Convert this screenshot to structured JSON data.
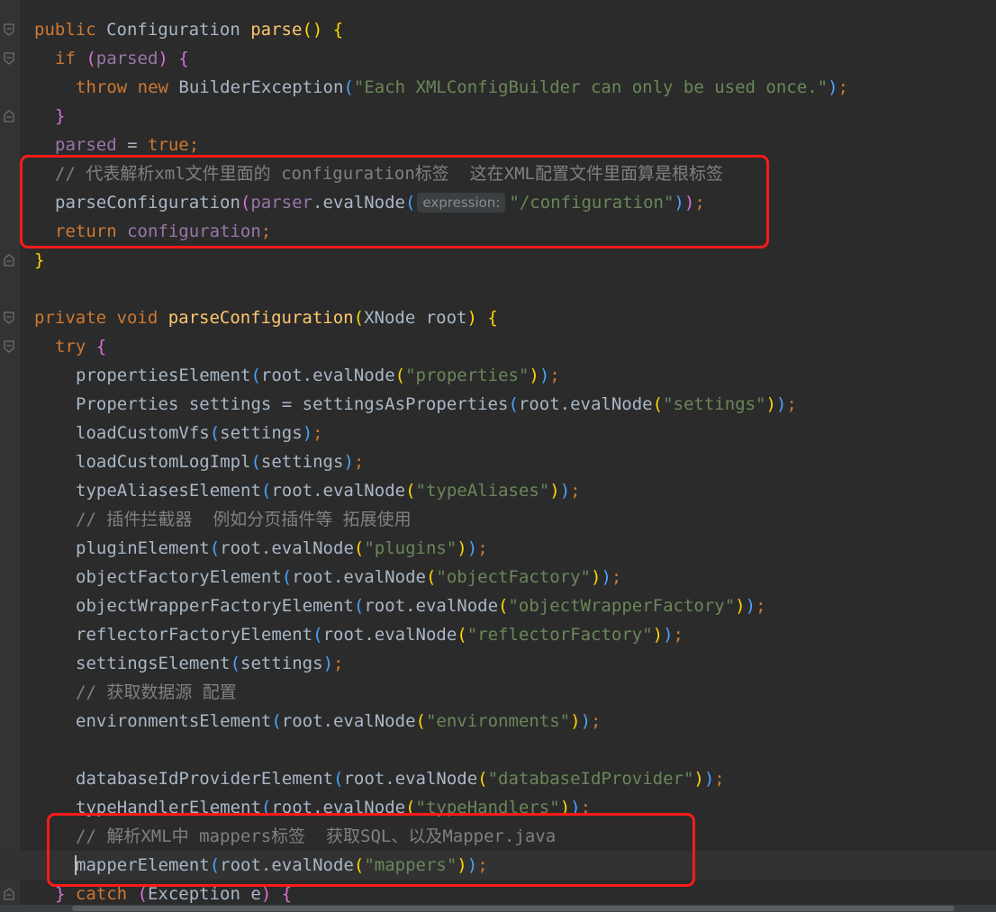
{
  "editor": {
    "colors": {
      "background": "#2b2b2b",
      "keyword": "#cc7832",
      "method": "#ffc66d",
      "string": "#6a8759",
      "field": "#9876aa",
      "comment": "#808080",
      "highlight_box": "#ff1a1a"
    },
    "highlights": [
      "parse-comment-block",
      "mapper-element-block"
    ],
    "lines": [
      {
        "indent": 0,
        "fold": "open",
        "tokens": [
          {
            "t": "public ",
            "c": "kw"
          },
          {
            "t": "Configuration ",
            "c": "pl"
          },
          {
            "t": "parse",
            "c": "fn"
          },
          {
            "t": "() ",
            "c": "b1"
          },
          {
            "t": "{",
            "c": "b1"
          }
        ]
      },
      {
        "indent": 1,
        "fold": "open",
        "tokens": [
          {
            "t": "if ",
            "c": "kw"
          },
          {
            "t": "(",
            "c": "b2"
          },
          {
            "t": "parsed",
            "c": "fld"
          },
          {
            "t": ") ",
            "c": "b2"
          },
          {
            "t": "{",
            "c": "b2"
          }
        ]
      },
      {
        "indent": 2,
        "tokens": [
          {
            "t": "throw new ",
            "c": "kw"
          },
          {
            "t": "BuilderException",
            "c": "pl"
          },
          {
            "t": "(",
            "c": "b3"
          },
          {
            "t": "\"Each XMLConfigBuilder can only be used once.\"",
            "c": "str"
          },
          {
            "t": ")",
            "c": "b3"
          },
          {
            "t": ";",
            "c": "kw"
          }
        ]
      },
      {
        "indent": 1,
        "fold": "close",
        "tokens": [
          {
            "t": "}",
            "c": "b2"
          }
        ]
      },
      {
        "indent": 1,
        "tokens": [
          {
            "t": "parsed",
            "c": "fld"
          },
          {
            "t": " = ",
            "c": "pl"
          },
          {
            "t": "true",
            "c": "kw"
          },
          {
            "t": ";",
            "c": "kw"
          }
        ]
      },
      {
        "indent": 1,
        "tokens": [
          {
            "t": "// 代表解析xml文件里面的 configuration标签  这在XML配置文件里面算是根标签",
            "c": "cmt"
          }
        ]
      },
      {
        "indent": 1,
        "tokens": [
          {
            "t": "parseConfiguration",
            "c": "pl"
          },
          {
            "t": "(",
            "c": "b2"
          },
          {
            "t": "parser",
            "c": "fld"
          },
          {
            "t": ".evalNode",
            "c": "pl"
          },
          {
            "t": "(",
            "c": "b3"
          },
          {
            "t": "expression:",
            "c": "hint"
          },
          {
            "t": "\"/configuration\"",
            "c": "str"
          },
          {
            "t": ")",
            "c": "b3"
          },
          {
            "t": ")",
            "c": "b2"
          },
          {
            "t": ";",
            "c": "kw"
          }
        ]
      },
      {
        "indent": 1,
        "tokens": [
          {
            "t": "return ",
            "c": "kw"
          },
          {
            "t": "configuration",
            "c": "fld"
          },
          {
            "t": ";",
            "c": "kw"
          }
        ]
      },
      {
        "indent": 0,
        "fold": "close",
        "tokens": [
          {
            "t": "}",
            "c": "b1"
          }
        ]
      },
      {
        "indent": 0,
        "tokens": []
      },
      {
        "indent": 0,
        "fold": "open",
        "tokens": [
          {
            "t": "private void ",
            "c": "kw"
          },
          {
            "t": "parseConfiguration",
            "c": "fn"
          },
          {
            "t": "(",
            "c": "b1"
          },
          {
            "t": "XNode root",
            "c": "pl"
          },
          {
            "t": ") ",
            "c": "b1"
          },
          {
            "t": "{",
            "c": "b1"
          }
        ]
      },
      {
        "indent": 1,
        "fold": "open",
        "tokens": [
          {
            "t": "try ",
            "c": "kw"
          },
          {
            "t": "{",
            "c": "b2"
          }
        ]
      },
      {
        "indent": 2,
        "tokens": [
          {
            "t": "propertiesElement",
            "c": "pl"
          },
          {
            "t": "(",
            "c": "b3"
          },
          {
            "t": "root.evalNode",
            "c": "pl"
          },
          {
            "t": "(",
            "c": "b1"
          },
          {
            "t": "\"properties\"",
            "c": "str"
          },
          {
            "t": ")",
            "c": "b1"
          },
          {
            "t": ")",
            "c": "b3"
          },
          {
            "t": ";",
            "c": "kw"
          }
        ]
      },
      {
        "indent": 2,
        "tokens": [
          {
            "t": "Properties settings = settingsAsProperties",
            "c": "pl"
          },
          {
            "t": "(",
            "c": "b3"
          },
          {
            "t": "root.evalNode",
            "c": "pl"
          },
          {
            "t": "(",
            "c": "b1"
          },
          {
            "t": "\"settings\"",
            "c": "str"
          },
          {
            "t": ")",
            "c": "b1"
          },
          {
            "t": ")",
            "c": "b3"
          },
          {
            "t": ";",
            "c": "kw"
          }
        ]
      },
      {
        "indent": 2,
        "tokens": [
          {
            "t": "loadCustomVfs",
            "c": "pl"
          },
          {
            "t": "(",
            "c": "b3"
          },
          {
            "t": "settings",
            "c": "pl"
          },
          {
            "t": ")",
            "c": "b3"
          },
          {
            "t": ";",
            "c": "kw"
          }
        ]
      },
      {
        "indent": 2,
        "tokens": [
          {
            "t": "loadCustomLogImpl",
            "c": "pl"
          },
          {
            "t": "(",
            "c": "b3"
          },
          {
            "t": "settings",
            "c": "pl"
          },
          {
            "t": ")",
            "c": "b3"
          },
          {
            "t": ";",
            "c": "kw"
          }
        ]
      },
      {
        "indent": 2,
        "tokens": [
          {
            "t": "typeAliasesElement",
            "c": "pl"
          },
          {
            "t": "(",
            "c": "b3"
          },
          {
            "t": "root.evalNode",
            "c": "pl"
          },
          {
            "t": "(",
            "c": "b1"
          },
          {
            "t": "\"typeAliases\"",
            "c": "str"
          },
          {
            "t": ")",
            "c": "b1"
          },
          {
            "t": ")",
            "c": "b3"
          },
          {
            "t": ";",
            "c": "kw"
          }
        ]
      },
      {
        "indent": 2,
        "tokens": [
          {
            "t": "// 插件拦截器  例如分页插件等 拓展使用",
            "c": "cmt"
          }
        ]
      },
      {
        "indent": 2,
        "tokens": [
          {
            "t": "pluginElement",
            "c": "pl"
          },
          {
            "t": "(",
            "c": "b3"
          },
          {
            "t": "root.evalNode",
            "c": "pl"
          },
          {
            "t": "(",
            "c": "b1"
          },
          {
            "t": "\"plugins\"",
            "c": "str"
          },
          {
            "t": ")",
            "c": "b1"
          },
          {
            "t": ")",
            "c": "b3"
          },
          {
            "t": ";",
            "c": "kw"
          }
        ]
      },
      {
        "indent": 2,
        "tokens": [
          {
            "t": "objectFactoryElement",
            "c": "pl"
          },
          {
            "t": "(",
            "c": "b3"
          },
          {
            "t": "root.evalNode",
            "c": "pl"
          },
          {
            "t": "(",
            "c": "b1"
          },
          {
            "t": "\"objectFactory\"",
            "c": "str"
          },
          {
            "t": ")",
            "c": "b1"
          },
          {
            "t": ")",
            "c": "b3"
          },
          {
            "t": ";",
            "c": "kw"
          }
        ]
      },
      {
        "indent": 2,
        "tokens": [
          {
            "t": "objectWrapperFactoryElement",
            "c": "pl"
          },
          {
            "t": "(",
            "c": "b3"
          },
          {
            "t": "root.evalNode",
            "c": "pl"
          },
          {
            "t": "(",
            "c": "b1"
          },
          {
            "t": "\"objectWrapperFactory\"",
            "c": "str"
          },
          {
            "t": ")",
            "c": "b1"
          },
          {
            "t": ")",
            "c": "b3"
          },
          {
            "t": ";",
            "c": "kw"
          }
        ]
      },
      {
        "indent": 2,
        "tokens": [
          {
            "t": "reflectorFactoryElement",
            "c": "pl"
          },
          {
            "t": "(",
            "c": "b3"
          },
          {
            "t": "root.evalNode",
            "c": "pl"
          },
          {
            "t": "(",
            "c": "b1"
          },
          {
            "t": "\"reflectorFactory\"",
            "c": "str"
          },
          {
            "t": ")",
            "c": "b1"
          },
          {
            "t": ")",
            "c": "b3"
          },
          {
            "t": ";",
            "c": "kw"
          }
        ]
      },
      {
        "indent": 2,
        "tokens": [
          {
            "t": "settingsElement",
            "c": "pl"
          },
          {
            "t": "(",
            "c": "b3"
          },
          {
            "t": "settings",
            "c": "pl"
          },
          {
            "t": ")",
            "c": "b3"
          },
          {
            "t": ";",
            "c": "kw"
          }
        ]
      },
      {
        "indent": 2,
        "tokens": [
          {
            "t": "// 获取数据源 配置",
            "c": "cmt"
          }
        ]
      },
      {
        "indent": 2,
        "tokens": [
          {
            "t": "environmentsElement",
            "c": "pl"
          },
          {
            "t": "(",
            "c": "b3"
          },
          {
            "t": "root.evalNode",
            "c": "pl"
          },
          {
            "t": "(",
            "c": "b1"
          },
          {
            "t": "\"environments\"",
            "c": "str"
          },
          {
            "t": ")",
            "c": "b1"
          },
          {
            "t": ")",
            "c": "b3"
          },
          {
            "t": ";",
            "c": "kw"
          }
        ]
      },
      {
        "indent": 0,
        "tokens": []
      },
      {
        "indent": 2,
        "tokens": [
          {
            "t": "databaseIdProviderElement",
            "c": "pl"
          },
          {
            "t": "(",
            "c": "b3"
          },
          {
            "t": "root.evalNode",
            "c": "pl"
          },
          {
            "t": "(",
            "c": "b1"
          },
          {
            "t": "\"databaseIdProvider\"",
            "c": "str"
          },
          {
            "t": ")",
            "c": "b1"
          },
          {
            "t": ")",
            "c": "b3"
          },
          {
            "t": ";",
            "c": "kw"
          }
        ]
      },
      {
        "indent": 2,
        "tokens": [
          {
            "t": "typeHandlerElement",
            "c": "pl"
          },
          {
            "t": "(",
            "c": "b3"
          },
          {
            "t": "root.evalNode",
            "c": "pl"
          },
          {
            "t": "(",
            "c": "b1"
          },
          {
            "t": "\"typeHandlers\"",
            "c": "str"
          },
          {
            "t": ")",
            "c": "b1"
          },
          {
            "t": ")",
            "c": "b3"
          },
          {
            "t": ";",
            "c": "kw"
          }
        ]
      },
      {
        "indent": 2,
        "tokens": [
          {
            "t": "// 解析XML中 mappers标签  获取SQL、以及Mapper.java",
            "c": "cmt"
          }
        ]
      },
      {
        "indent": 2,
        "caret": true,
        "tokens": [
          {
            "t": "mapperElement",
            "c": "pl"
          },
          {
            "t": "(",
            "c": "b3"
          },
          {
            "t": "root.evalNode",
            "c": "pl"
          },
          {
            "t": "(",
            "c": "b1"
          },
          {
            "t": "\"mappers\"",
            "c": "str"
          },
          {
            "t": ")",
            "c": "b1"
          },
          {
            "t": ")",
            "c": "b3"
          },
          {
            "t": ";",
            "c": "kw"
          }
        ]
      },
      {
        "indent": 1,
        "fold": "close",
        "tokens": [
          {
            "t": "} ",
            "c": "b2"
          },
          {
            "t": "catch ",
            "c": "kw"
          },
          {
            "t": "(",
            "c": "b2"
          },
          {
            "t": "Exception e",
            "c": "pl"
          },
          {
            "t": ") ",
            "c": "b2"
          },
          {
            "t": "{",
            "c": "b2"
          }
        ]
      }
    ]
  }
}
